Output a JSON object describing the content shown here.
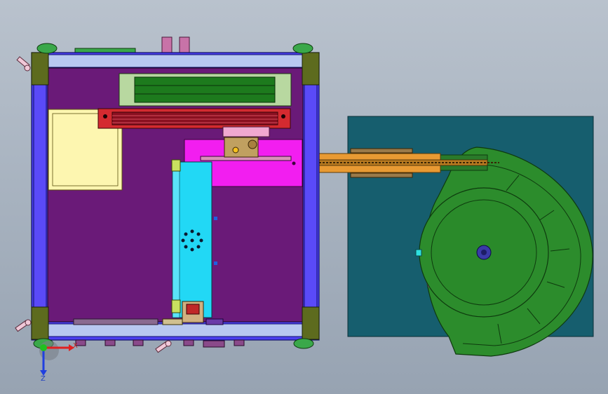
{
  "viewport": {
    "background_top": "#b9c2cd",
    "background_bottom": "#97a3b2"
  },
  "model": {
    "frame_color": "#4b3ff0",
    "panel_color": "#6a1a78",
    "corner_post_color": "#5d6b1e",
    "guide_rail_color": "#1d7a1d",
    "rail_bar_color": "#c0202a",
    "carriage_color": "#f21ef0",
    "vertical_slide_color": "#22d8f5",
    "label_plate_color": "#fdf6b0",
    "feeder_base_color": "#165e6e",
    "feeder_bowl_color": "#2c8c2c",
    "conveyor_color": "#e89a33"
  },
  "triad": {
    "x_label": "X",
    "z_label": "Z",
    "x_axis_color": "#e02020",
    "y_axis_color": "#20c020",
    "z_axis_color": "#2040e0"
  }
}
